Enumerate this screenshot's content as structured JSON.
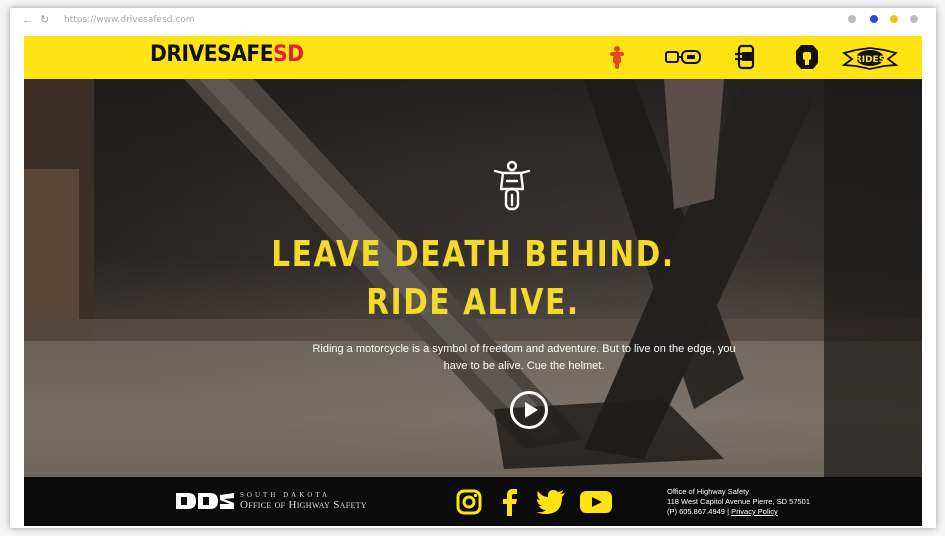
{
  "browser": {
    "url": "https://www.drivesafesd.com"
  },
  "header": {
    "logo_part1": "DRIVESAFE",
    "logo_part2": "SD",
    "nav_icons": [
      "motorcycle-nav-icon",
      "seatbelt-nav-icon",
      "phone-distracted-nav-icon",
      "helmet-nav-icon",
      "rides-badge-nav-icon"
    ],
    "rides_label": "RIDES"
  },
  "hero": {
    "headline_line1": "LEAVE DEATH BEHIND.",
    "headline_line2": "RIDE ALIVE.",
    "subtext_line1": "Riding a motorcycle is a symbol of freedom and adventure. But to live on the edge, you",
    "subtext_line2": "have to be alive. Cue the helmet."
  },
  "footer": {
    "org_state": "SOUTH DAKOTA",
    "org_name": "Office of Highway Safety",
    "social": [
      "instagram-icon",
      "facebook-icon",
      "twitter-icon",
      "youtube-icon"
    ],
    "address_line1": "Office of Highway Safety",
    "address_line2": "118 West Capitol Avenue Pierre, SD 57501",
    "phone": "(P) 605.867.4949",
    "separator": "|",
    "privacy_label": "Privacy Policy"
  },
  "colors": {
    "brand_yellow": "#ffe313",
    "brand_red": "#e0203a",
    "headline_yellow": "#f5d92a",
    "footer_black": "#0b0b0b"
  }
}
